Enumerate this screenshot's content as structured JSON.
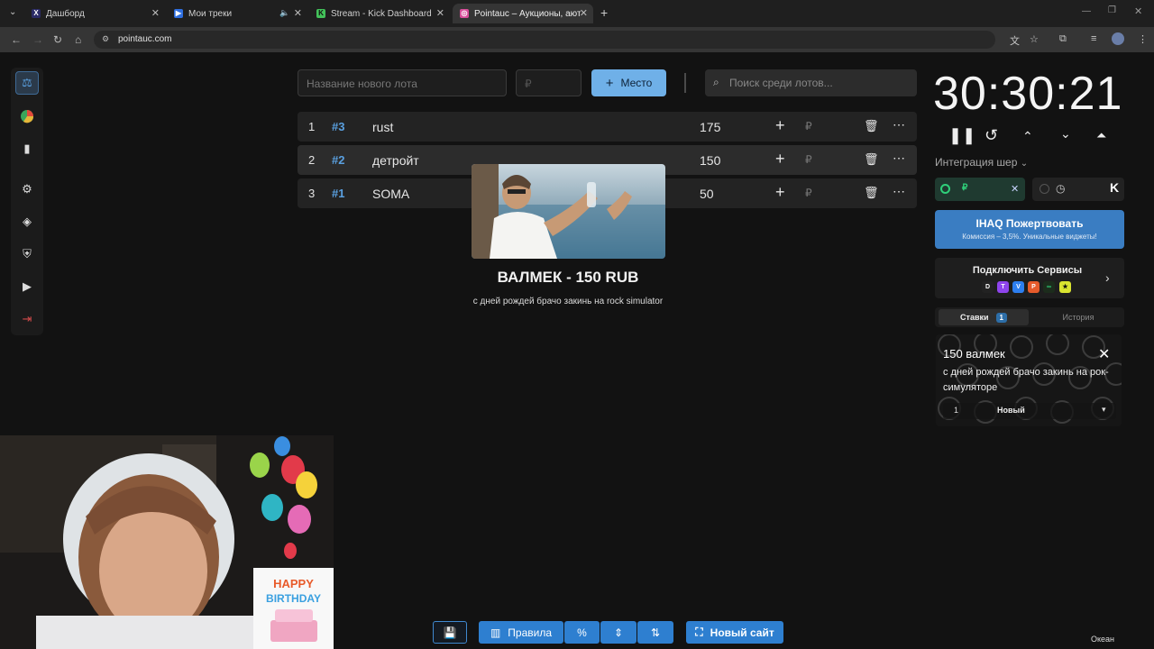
{
  "browser": {
    "tabs": [
      {
        "title": "Дашборд",
        "favicon": "X",
        "fav_color": "#2b2b66"
      },
      {
        "title": "Мои треки",
        "favicon": "▶",
        "fav_color": "#2f6fe0"
      },
      {
        "title": "Stream - Kick Dashboard",
        "favicon": "K",
        "fav_color": "#43c15a"
      },
      {
        "title": "Pointauc – Аукционы, аюте…",
        "favicon": "◎",
        "fav_color": "#d84d9a"
      }
    ],
    "url": "pointauc.com"
  },
  "form": {
    "lot_name_placeholder": "Название нового лота",
    "price_placeholder": "₽",
    "add_label": "Место",
    "search_placeholder": "Поиск среди лотов..."
  },
  "lots": [
    {
      "n": "1",
      "id": "#3",
      "name": "rust",
      "amount": "175",
      "currency": "₽"
    },
    {
      "n": "2",
      "id": "#2",
      "name": "детройт",
      "amount": "150",
      "currency": "₽"
    },
    {
      "n": "3",
      "id": "#1",
      "name": "SOMA",
      "amount": "50",
      "currency": "₽"
    }
  ],
  "popup": {
    "title": "ВАЛМЕК - 150 RUB",
    "message": "с дней рождей брачо закинь на rock simulator"
  },
  "timer": {
    "display": "30:30:21"
  },
  "integration": {
    "label": "Интеграция шер",
    "currency": "₽"
  },
  "donate": {
    "title": "IHAQ Пожертвовать",
    "subtitle": "Комиссия – 3,5%. Уникальные виджеты!"
  },
  "connect": {
    "title": "Подключить Сервисы"
  },
  "bids_tabs": {
    "bids": "Ставки",
    "bids_count": "1",
    "history": "История"
  },
  "bid": {
    "title": "150 валмек",
    "message": "с дней рождей брачо закинь на рок-симуляторе",
    "qty": "1",
    "status": "Новый"
  },
  "bottom": {
    "rules": "Правила",
    "percent": "%",
    "new_site": "Новый сайт"
  },
  "overlay": {
    "birthday_line1": "HAPPY",
    "birthday_line2": "BIRTHDAY",
    "streamer_name": "Океан"
  },
  "colors": {
    "accent": "#2e7fd0",
    "id_blue": "#5aa0e0",
    "add_button": "#6fb0e8"
  }
}
